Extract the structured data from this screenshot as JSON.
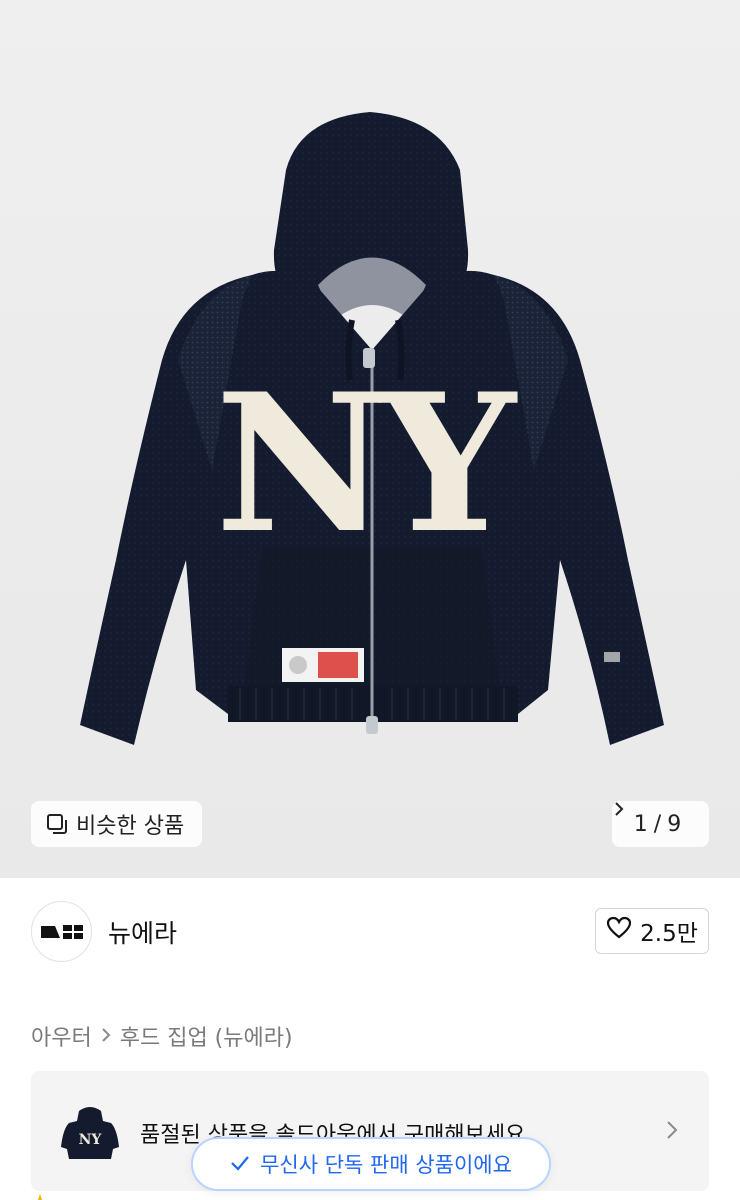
{
  "gallery": {
    "similar_label": "비슷한 상품",
    "current_index": "1",
    "separator": "/",
    "total": "9",
    "product_image_text": "NY"
  },
  "brand": {
    "name": "뉴에라",
    "like_count": "2.5만"
  },
  "breadcrumb": {
    "items": [
      "아우터",
      "후드 집업 (뉴에라)"
    ]
  },
  "soldout_banner": {
    "message": "품절된 상품을 솔드아웃에서 구매해보세요."
  },
  "exclusive_toast": {
    "label": "무신사 단독 판매 상품이에요"
  },
  "colors": {
    "accent_blue": "#1f67ee",
    "hoodie_navy": "#141b2e",
    "letter_cream": "#efeadb"
  }
}
